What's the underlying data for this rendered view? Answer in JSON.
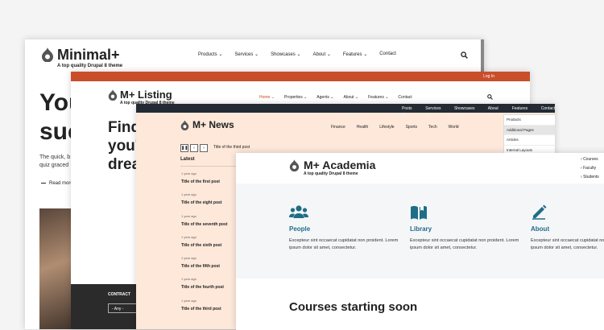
{
  "colors": {
    "listing_accent": "#c94f2a",
    "news_bg": "#fde8da",
    "academia_accent": "#1f6d86",
    "dark_bar": "#232a33"
  },
  "minimal": {
    "logo_title": "Minimal+",
    "tagline": "A top quality Drupal 8 theme",
    "nav": [
      "Products ⌄",
      "Services ⌄",
      "Showcases ⌄",
      "About ⌄",
      "Features ⌄",
      "Contact"
    ],
    "hero_lines": [
      "You",
      "suc"
    ],
    "body": "The quick, b quiz graced",
    "read_more": "Read more"
  },
  "listing": {
    "login": "Log In",
    "logo_title": "M+ Listing",
    "tagline": "A top quality Drupal 8 theme",
    "nav": [
      "Home ⌄",
      "Properties ⌄",
      "Agents ⌄",
      "About ⌄",
      "Features ⌄",
      "Contact"
    ],
    "hero_lines": [
      "Find",
      "you'",
      "drea"
    ],
    "contract_label": "CONTRACT",
    "contract_select": "- Any -"
  },
  "news": {
    "top_nav": [
      "Posts ⌄",
      "Services ⌄",
      "Showcases ⌄",
      "About ⌄",
      "Features ⌄",
      "Contact"
    ],
    "logo_title": "M+ News",
    "nav": [
      "Finance",
      "Health",
      "Lifestyle",
      "Sports",
      "Tech",
      "World"
    ],
    "ticker_controls": [
      "❚❚",
      "‹",
      "›"
    ],
    "ticker_text": "Title of the third post",
    "latest_label": "Latest",
    "items": [
      {
        "ago": "1 year ago",
        "title": "Title of the first post"
      },
      {
        "ago": "1 year ago",
        "title": "Title of the eight post"
      },
      {
        "ago": "1 year ago",
        "title": "Title of the seventh post"
      },
      {
        "ago": "1 year ago",
        "title": "Title of the sixth post"
      },
      {
        "ago": "1 year ago",
        "title": "Title of the fifth post"
      },
      {
        "ago": "1 year ago",
        "title": "Title of the fourth post"
      },
      {
        "ago": "1 year ago",
        "title": "Title of the third post"
      }
    ],
    "dropdown": [
      "Products",
      "Additional Pages",
      "Articles",
      "Internal Layouts"
    ]
  },
  "academia": {
    "logo_title": "M+ Academia",
    "tagline": "A top quality Drupal 8 theme",
    "side_nav": [
      "Courses",
      "Faculty",
      "Students"
    ],
    "features": [
      {
        "icon": "people-icon",
        "title": "People",
        "text": "Excepteur sint occaecat cupidatat non proident. Lorem ipsum dolor sit amet, consectetur."
      },
      {
        "icon": "library-icon",
        "title": "Library",
        "text": "Excepteur sint occaecat cupidatat non proident. Lorem ipsum dolor sit amet, consectetur."
      },
      {
        "icon": "pencil-icon",
        "title": "About",
        "text": "Excepteur sint occaecat cupidatat non proident. Lorem ipsum dolor sit amet, consectetur."
      }
    ],
    "courses_heading": "Courses starting soon"
  }
}
